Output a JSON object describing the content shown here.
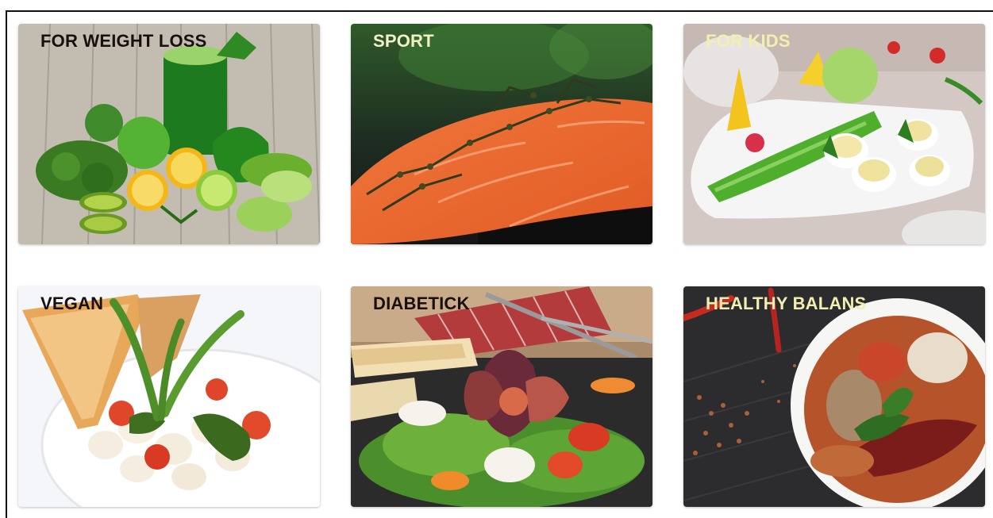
{
  "categories": [
    {
      "title": "FOR WEIGHT LOSS",
      "title_color": "#1a0f0f"
    },
    {
      "title": "SPORT",
      "title_color": "#f3efc4"
    },
    {
      "title": "FOR KIDS",
      "title_color": "#f3efb0"
    },
    {
      "title": "VEGAN",
      "title_color": "#1a0f0f"
    },
    {
      "title": "DIABETICK",
      "title_color": "#1a0f0f"
    },
    {
      "title": "HEALTHY BALANS",
      "title_color": "#f3efb0"
    }
  ]
}
